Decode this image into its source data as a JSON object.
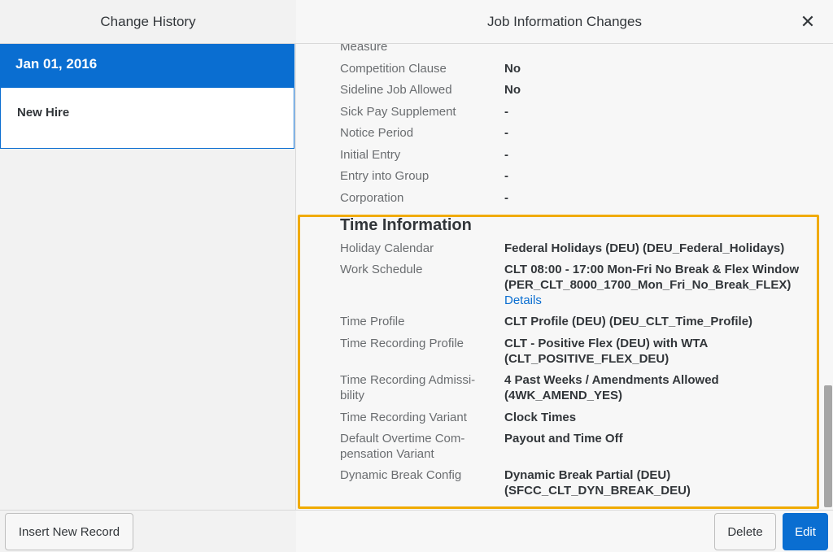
{
  "left": {
    "header": "Change History",
    "history_date": "Jan 01, 2016",
    "history_event": "New Hire",
    "insert_button": "Insert New Record"
  },
  "right": {
    "header": "Job Information Changes",
    "close_glyph": "✕",
    "delete_button": "Delete",
    "edit_button": "Edit"
  },
  "fields_top": [
    {
      "label": "Measure",
      "value": ""
    },
    {
      "label": "Competition Clause",
      "value": "No"
    },
    {
      "label": "Sideline Job Allowed",
      "value": "No"
    },
    {
      "label": "Sick Pay Supplement",
      "value": "-"
    },
    {
      "label": "Notice Period",
      "value": "-"
    },
    {
      "label": "Initial Entry",
      "value": "-"
    },
    {
      "label": "Entry into Group",
      "value": "-"
    },
    {
      "label": "Corporation",
      "value": "-"
    }
  ],
  "time_section": {
    "title": "Time Information",
    "holiday_calendar": {
      "label": "Holiday Calendar",
      "value": "Federal Holidays (DEU) (DEU_Federal_Holidays)"
    },
    "work_schedule": {
      "label": "Work Schedule",
      "value_line1": "CLT 08:00 - 17:00 Mon-Fri No Break & Flex Window",
      "value_line2": "(PER_CLT_8000_1700_Mon_Fri_No_Break_FLEX)",
      "link": "Details"
    },
    "time_profile": {
      "label": "Time Profile",
      "value": "CLT Profile (DEU) (DEU_CLT_Time_Profile)"
    },
    "time_recording_profile": {
      "label": "Time Recording Profile",
      "value_line1": "CLT - Positive Flex (DEU) with WTA",
      "value_line2": "(CLT_POSITIVE_FLEX_DEU)"
    },
    "time_recording_admissibility": {
      "label_line1": "Time Recording Admissi-",
      "label_line2": "bility",
      "value_line1": "4 Past Weeks / Amendments Allowed",
      "value_line2": "(4WK_AMEND_YES)"
    },
    "time_recording_variant": {
      "label": "Time Recording Variant",
      "value": "Clock Times"
    },
    "default_overtime": {
      "label_line1": "Default Overtime Com-",
      "label_line2": "pensation Variant",
      "value": "Payout and Time Off"
    },
    "dynamic_break": {
      "label": "Dynamic Break Config",
      "value_line1": "Dynamic Break Partial (DEU)",
      "value_line2": "(SFCC_CLT_DYN_BREAK_DEU)"
    }
  },
  "colors": {
    "accent": "#0a6ed1",
    "highlight": "#f0ab00"
  }
}
